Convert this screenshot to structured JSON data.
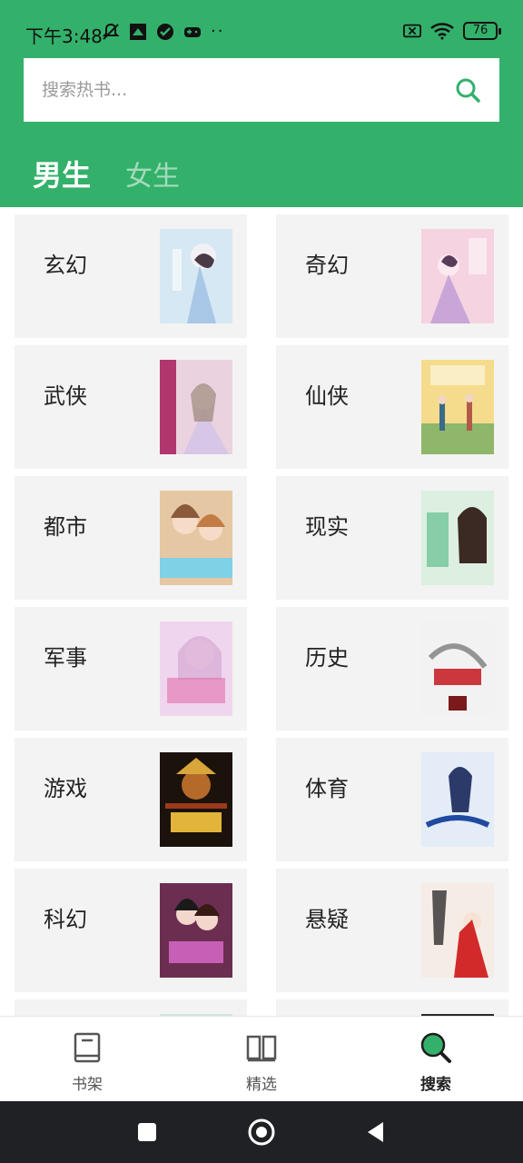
{
  "status_bar": {
    "time": "下午3:48",
    "dots": "··",
    "battery": "76"
  },
  "search": {
    "placeholder": "搜索热书..."
  },
  "tabs": [
    {
      "label": "男生",
      "active": true
    },
    {
      "label": "女生",
      "active": false
    }
  ],
  "categories": [
    {
      "label": "玄幻",
      "cover_color": "#cfe3f0"
    },
    {
      "label": "奇幻",
      "cover_color": "#f3c6d6"
    },
    {
      "label": "武侠",
      "cover_color": "#e9c9d8"
    },
    {
      "label": "仙侠",
      "cover_color": "#f2d27a"
    },
    {
      "label": "都市",
      "cover_color": "#c8a583"
    },
    {
      "label": "现实",
      "cover_color": "#cfe9d4"
    },
    {
      "label": "军事",
      "cover_color": "#e8c8e6"
    },
    {
      "label": "历史",
      "cover_color": "#ececec"
    },
    {
      "label": "游戏",
      "cover_color": "#2a1a12"
    },
    {
      "label": "体育",
      "cover_color": "#dfe7f5"
    },
    {
      "label": "科幻",
      "cover_color": "#7b3a5c"
    },
    {
      "label": "悬疑",
      "cover_color": "#f4e6e0"
    }
  ],
  "bottom_nav": [
    {
      "label": "书架",
      "icon": "bookshelf-icon",
      "active": false
    },
    {
      "label": "精选",
      "icon": "open-book-icon",
      "active": false
    },
    {
      "label": "搜索",
      "icon": "search-icon",
      "active": true
    }
  ],
  "colors": {
    "brand_green": "#33b06a",
    "card_bg": "#f3f3f3",
    "system_nav_bg": "#1f2125"
  }
}
